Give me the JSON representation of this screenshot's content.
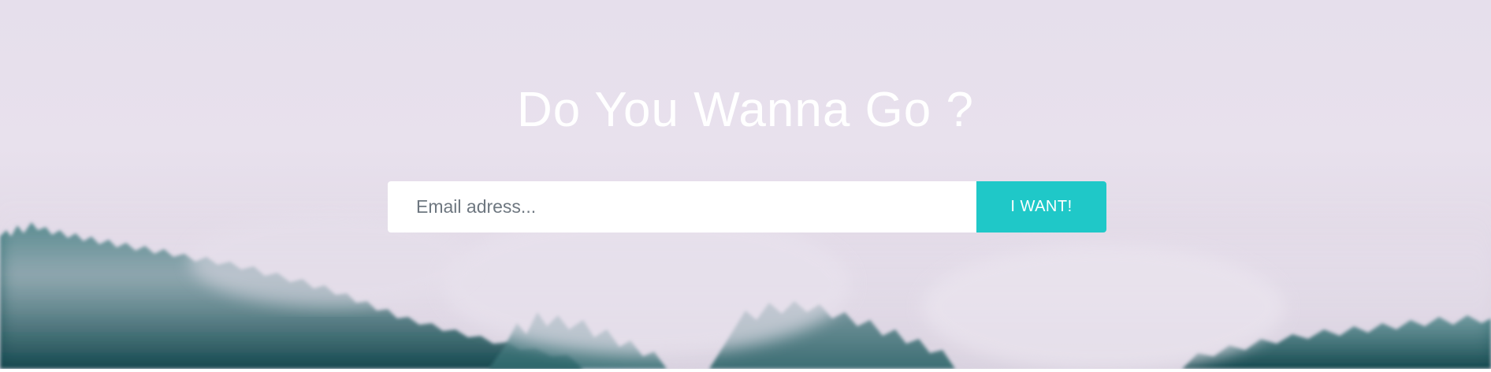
{
  "hero": {
    "headline": "Do You Wanna Go ?",
    "background_image": "misty-forest-hillside"
  },
  "signup_form": {
    "email_placeholder": "Email adress...",
    "submit_label": "I WANT!",
    "accent_color": "#1fc8c8"
  }
}
